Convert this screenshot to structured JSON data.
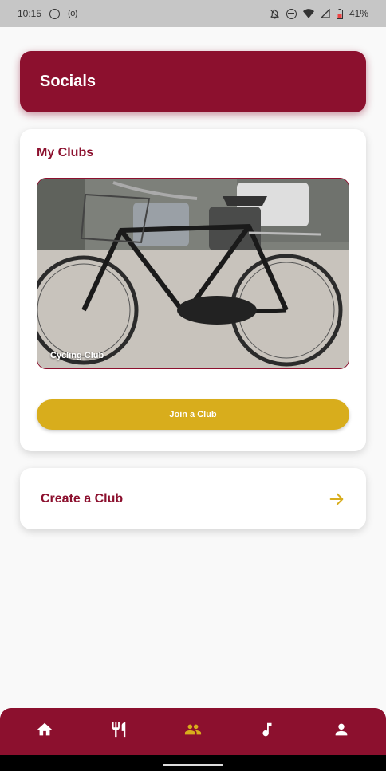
{
  "status_bar": {
    "time": "10:15",
    "indicator": "(o)",
    "battery": "41%"
  },
  "header": {
    "title": "Socials"
  },
  "my_clubs": {
    "title": "My Clubs",
    "clubs": [
      {
        "name": "Cycling Club"
      }
    ],
    "join_label": "Join a Club"
  },
  "create_club": {
    "label": "Create a Club"
  },
  "colors": {
    "brand": "#8c102e",
    "accent": "#d8ad1c",
    "nav_active": "#d8ad1c"
  },
  "bottom_nav": {
    "items": [
      {
        "icon": "home-icon",
        "active": false
      },
      {
        "icon": "restaurant-icon",
        "active": false
      },
      {
        "icon": "people-icon",
        "active": true
      },
      {
        "icon": "music-note-icon",
        "active": false
      },
      {
        "icon": "person-icon",
        "active": false
      }
    ]
  }
}
